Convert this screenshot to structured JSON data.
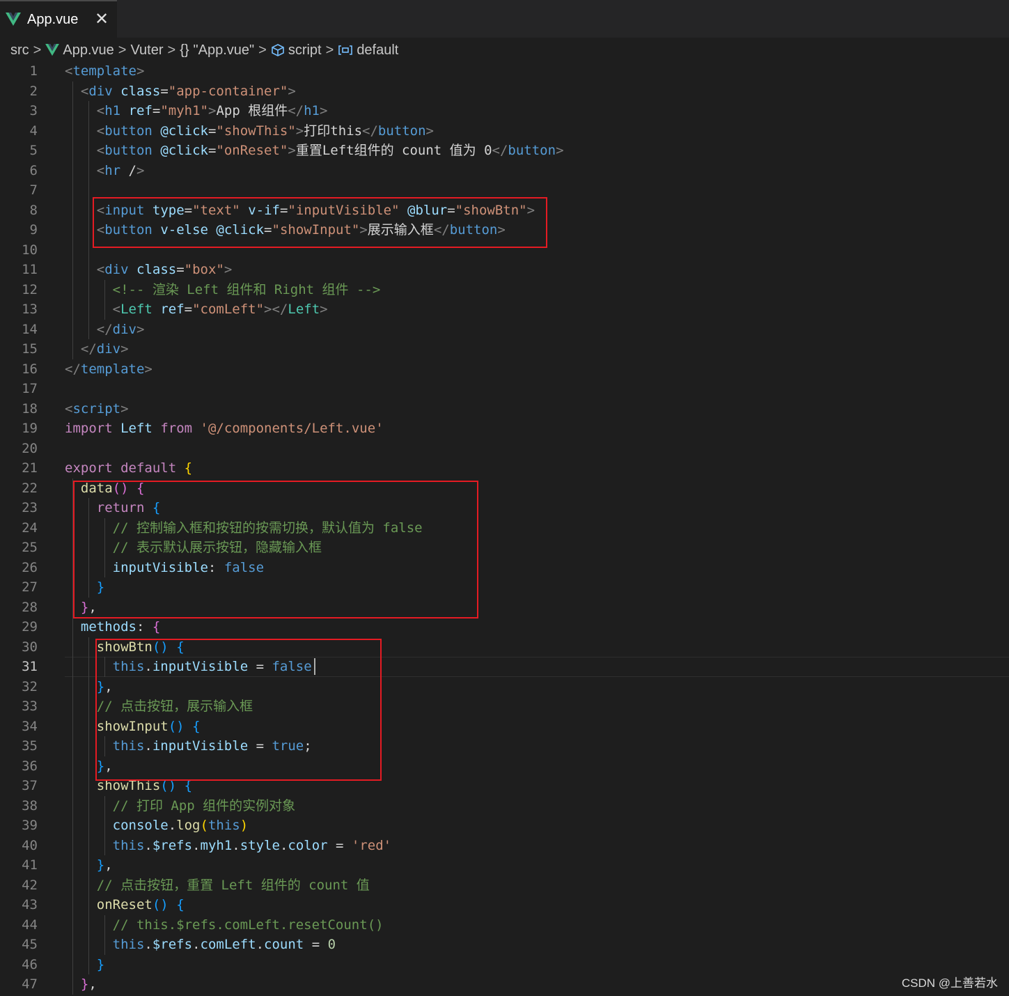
{
  "tab": {
    "title": "App.vue",
    "close_glyph": "✕",
    "icon": "vue-logo-icon"
  },
  "breadcrumb": {
    "items": [
      {
        "label": "src",
        "icon": ""
      },
      {
        "label": "App.vue",
        "icon": "vue-logo-icon"
      },
      {
        "label": "Vuter",
        "icon": ""
      },
      {
        "label": "\"App.vue\"",
        "icon": "braces-icon"
      },
      {
        "label": "script",
        "icon": "cube-icon"
      },
      {
        "label": "default",
        "icon": "variable-icon"
      }
    ],
    "separator": ">"
  },
  "editor": {
    "active_line": 31,
    "lines": [
      [
        [
          "<",
          "punct"
        ],
        [
          "template",
          "tag"
        ],
        [
          ">",
          "punct"
        ]
      ],
      [
        [
          "  "
        ],
        [
          "<",
          "punct"
        ],
        [
          "div",
          "tag"
        ],
        [
          " "
        ],
        [
          "class",
          "attr"
        ],
        [
          "=",
          "text"
        ],
        [
          "\"app-container\"",
          "str"
        ],
        [
          ">",
          "punct"
        ]
      ],
      [
        [
          "    "
        ],
        [
          "<",
          "punct"
        ],
        [
          "h1",
          "tag"
        ],
        [
          " "
        ],
        [
          "ref",
          "attr"
        ],
        [
          "=",
          "text"
        ],
        [
          "\"myh1\"",
          "str"
        ],
        [
          ">",
          "punct"
        ],
        [
          "App 根组件",
          "text"
        ],
        [
          "</",
          "punct"
        ],
        [
          "h1",
          "tag"
        ],
        [
          ">",
          "punct"
        ]
      ],
      [
        [
          "    "
        ],
        [
          "<",
          "punct"
        ],
        [
          "button",
          "tag"
        ],
        [
          " "
        ],
        [
          "@click",
          "attr"
        ],
        [
          "=",
          "text"
        ],
        [
          "\"showThis\"",
          "str"
        ],
        [
          ">",
          "punct"
        ],
        [
          "打印this",
          "text"
        ],
        [
          "</",
          "punct"
        ],
        [
          "button",
          "tag"
        ],
        [
          ">",
          "punct"
        ]
      ],
      [
        [
          "    "
        ],
        [
          "<",
          "punct"
        ],
        [
          "button",
          "tag"
        ],
        [
          " "
        ],
        [
          "@click",
          "attr"
        ],
        [
          "=",
          "text"
        ],
        [
          "\"onReset\"",
          "str"
        ],
        [
          ">",
          "punct"
        ],
        [
          "重置Left组件的 count 值为 0",
          "text"
        ],
        [
          "</",
          "punct"
        ],
        [
          "button",
          "tag"
        ],
        [
          ">",
          "punct"
        ]
      ],
      [
        [
          "    "
        ],
        [
          "<",
          "punct"
        ],
        [
          "hr",
          "tag"
        ],
        [
          " /",
          "text"
        ],
        [
          ">",
          "punct"
        ]
      ],
      [],
      [
        [
          "    "
        ],
        [
          "<",
          "punct"
        ],
        [
          "input",
          "tag"
        ],
        [
          " "
        ],
        [
          "type",
          "attr"
        ],
        [
          "=",
          "text"
        ],
        [
          "\"text\"",
          "str"
        ],
        [
          " "
        ],
        [
          "v-if",
          "attr"
        ],
        [
          "=",
          "text"
        ],
        [
          "\"inputVisible\"",
          "str"
        ],
        [
          " "
        ],
        [
          "@blur",
          "attr"
        ],
        [
          "=",
          "text"
        ],
        [
          "\"showBtn\"",
          "str"
        ],
        [
          ">",
          "punct"
        ]
      ],
      [
        [
          "    "
        ],
        [
          "<",
          "punct"
        ],
        [
          "button",
          "tag"
        ],
        [
          " "
        ],
        [
          "v-else",
          "attr"
        ],
        [
          " "
        ],
        [
          "@click",
          "attr"
        ],
        [
          "=",
          "text"
        ],
        [
          "\"showInput\"",
          "str"
        ],
        [
          ">",
          "punct"
        ],
        [
          "展示输入框",
          "text"
        ],
        [
          "</",
          "punct"
        ],
        [
          "button",
          "tag"
        ],
        [
          ">",
          "punct"
        ]
      ],
      [],
      [
        [
          "    "
        ],
        [
          "<",
          "punct"
        ],
        [
          "div",
          "tag"
        ],
        [
          " "
        ],
        [
          "class",
          "attr"
        ],
        [
          "=",
          "text"
        ],
        [
          "\"box\"",
          "str"
        ],
        [
          ">",
          "punct"
        ]
      ],
      [
        [
          "      "
        ],
        [
          "<!-- 渲染 Left 组件和 Right 组件 -->",
          "cmt"
        ]
      ],
      [
        [
          "      "
        ],
        [
          "<",
          "punct"
        ],
        [
          "Left",
          "comp"
        ],
        [
          " "
        ],
        [
          "ref",
          "attr"
        ],
        [
          "=",
          "text"
        ],
        [
          "\"comLeft\"",
          "str"
        ],
        [
          "></",
          "punct"
        ],
        [
          "Left",
          "comp"
        ],
        [
          ">",
          "punct"
        ]
      ],
      [
        [
          "    "
        ],
        [
          "</",
          "punct"
        ],
        [
          "div",
          "tag"
        ],
        [
          ">",
          "punct"
        ]
      ],
      [
        [
          "  "
        ],
        [
          "</",
          "punct"
        ],
        [
          "div",
          "tag"
        ],
        [
          ">",
          "punct"
        ]
      ],
      [
        [
          "</",
          "punct"
        ],
        [
          "template",
          "tag"
        ],
        [
          ">",
          "punct"
        ]
      ],
      [],
      [
        [
          "<",
          "punct"
        ],
        [
          "script",
          "tag"
        ],
        [
          ">",
          "punct"
        ]
      ],
      [
        [
          "import",
          "kw"
        ],
        [
          " "
        ],
        [
          "Left",
          "var"
        ],
        [
          " "
        ],
        [
          "from",
          "kw"
        ],
        [
          " "
        ],
        [
          "'@/components/Left.vue'",
          "str"
        ]
      ],
      [],
      [
        [
          "export",
          "kw"
        ],
        [
          " "
        ],
        [
          "default",
          "kw"
        ],
        [
          " "
        ],
        [
          "{",
          "b1"
        ]
      ],
      [
        [
          "  "
        ],
        [
          "data",
          "fn"
        ],
        [
          "()",
          "b2"
        ],
        [
          " "
        ],
        [
          "{",
          "b2"
        ]
      ],
      [
        [
          "    "
        ],
        [
          "return",
          "kw"
        ],
        [
          " "
        ],
        [
          "{",
          "b3"
        ]
      ],
      [
        [
          "      "
        ],
        [
          "// 控制输入框和按钮的按需切换，默认值为 false",
          "cmt"
        ]
      ],
      [
        [
          "      "
        ],
        [
          "// 表示默认展示按钮，隐藏输入框",
          "cmt"
        ]
      ],
      [
        [
          "      "
        ],
        [
          "inputVisible",
          "var"
        ],
        [
          ": ",
          "text"
        ],
        [
          "false",
          "bool"
        ]
      ],
      [
        [
          "    "
        ],
        [
          "}",
          "b3"
        ]
      ],
      [
        [
          "  "
        ],
        [
          "}",
          "b2"
        ],
        [
          ",",
          "text"
        ]
      ],
      [
        [
          "  "
        ],
        [
          "methods",
          "var"
        ],
        [
          ": ",
          "text"
        ],
        [
          "{",
          "b2"
        ]
      ],
      [
        [
          "    "
        ],
        [
          "showBtn",
          "fn"
        ],
        [
          "()",
          "b3"
        ],
        [
          " "
        ],
        [
          "{",
          "b3"
        ]
      ],
      [
        [
          "      "
        ],
        [
          "this",
          "bool"
        ],
        [
          ".",
          "text"
        ],
        [
          "inputVisible",
          "var"
        ],
        [
          " = ",
          "text"
        ],
        [
          "false",
          "bool"
        ]
      ],
      [
        [
          "    "
        ],
        [
          "}",
          "b3"
        ],
        [
          ",",
          "text"
        ]
      ],
      [
        [
          "    "
        ],
        [
          "// 点击按钮，展示输入框",
          "cmt"
        ]
      ],
      [
        [
          "    "
        ],
        [
          "showInput",
          "fn"
        ],
        [
          "()",
          "b3"
        ],
        [
          " "
        ],
        [
          "{",
          "b3"
        ]
      ],
      [
        [
          "      "
        ],
        [
          "this",
          "bool"
        ],
        [
          ".",
          "text"
        ],
        [
          "inputVisible",
          "var"
        ],
        [
          " = ",
          "text"
        ],
        [
          "true",
          "bool"
        ],
        [
          ";",
          "text"
        ]
      ],
      [
        [
          "    "
        ],
        [
          "}",
          "b3"
        ],
        [
          ",",
          "text"
        ]
      ],
      [
        [
          "    "
        ],
        [
          "showThis",
          "fn"
        ],
        [
          "()",
          "b3"
        ],
        [
          " "
        ],
        [
          "{",
          "b3"
        ]
      ],
      [
        [
          "      "
        ],
        [
          "// 打印 App 组件的实例对象",
          "cmt"
        ]
      ],
      [
        [
          "      "
        ],
        [
          "console",
          "var"
        ],
        [
          ".",
          "text"
        ],
        [
          "log",
          "fn"
        ],
        [
          "(",
          "b1"
        ],
        [
          "this",
          "bool"
        ],
        [
          ")",
          "b1"
        ]
      ],
      [
        [
          "      "
        ],
        [
          "this",
          "bool"
        ],
        [
          ".",
          "text"
        ],
        [
          "$refs",
          "var"
        ],
        [
          ".",
          "text"
        ],
        [
          "myh1",
          "var"
        ],
        [
          ".",
          "text"
        ],
        [
          "style",
          "var"
        ],
        [
          ".",
          "text"
        ],
        [
          "color",
          "var"
        ],
        [
          " = ",
          "text"
        ],
        [
          "'red'",
          "str"
        ]
      ],
      [
        [
          "    "
        ],
        [
          "}",
          "b3"
        ],
        [
          ",",
          "text"
        ]
      ],
      [
        [
          "    "
        ],
        [
          "// 点击按钮，重置 Left 组件的 count 值",
          "cmt"
        ]
      ],
      [
        [
          "    "
        ],
        [
          "onReset",
          "fn"
        ],
        [
          "()",
          "b3"
        ],
        [
          " "
        ],
        [
          "{",
          "b3"
        ]
      ],
      [
        [
          "      "
        ],
        [
          "// this.$refs.comLeft.resetCount()",
          "cmt"
        ]
      ],
      [
        [
          "      "
        ],
        [
          "this",
          "bool"
        ],
        [
          ".",
          "text"
        ],
        [
          "$refs",
          "var"
        ],
        [
          ".",
          "text"
        ],
        [
          "comLeft",
          "var"
        ],
        [
          ".",
          "text"
        ],
        [
          "count",
          "var"
        ],
        [
          " = ",
          "text"
        ],
        [
          "0",
          "num"
        ]
      ],
      [
        [
          "    "
        ],
        [
          "}",
          "b3"
        ]
      ],
      [
        [
          "  "
        ],
        [
          "}",
          "b2"
        ],
        [
          ",",
          "text"
        ]
      ]
    ]
  },
  "colors": {
    "highlight_box": "#e51b23",
    "background": "#1e1e1e"
  },
  "watermark": "CSDN @上善若水"
}
